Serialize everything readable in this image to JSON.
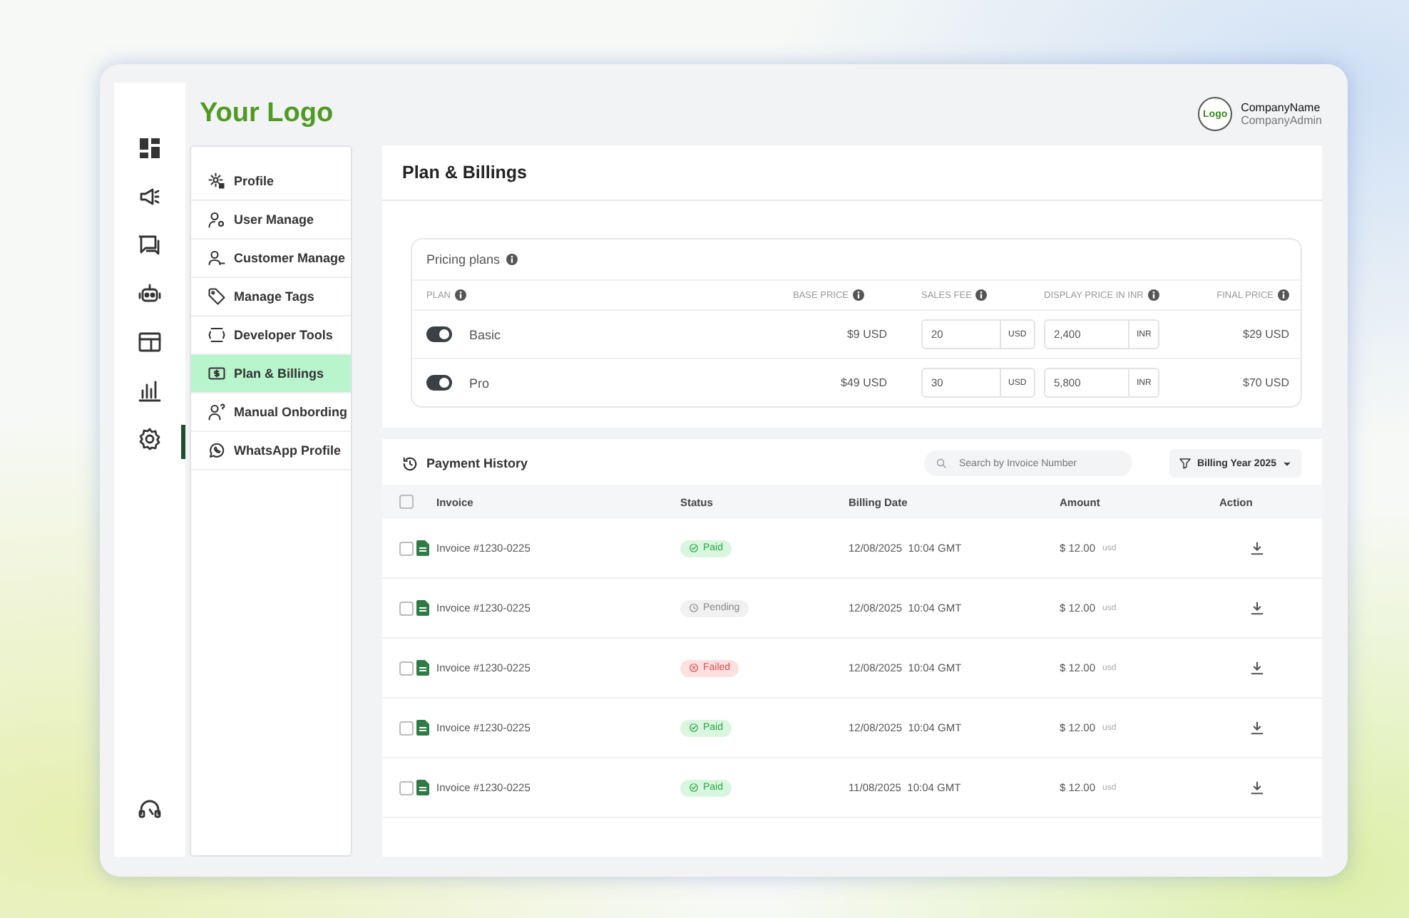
{
  "logo": "Your Logo",
  "company": {
    "avatar": "Logo",
    "name": "CompanyName",
    "role": "CompanyAdmin"
  },
  "rail": [
    {
      "kind": "dashboard",
      "selected": false
    },
    {
      "kind": "megaphone",
      "selected": false
    },
    {
      "kind": "chat",
      "selected": false
    },
    {
      "kind": "robot",
      "selected": false
    },
    {
      "kind": "layout",
      "selected": false
    },
    {
      "kind": "chart",
      "selected": false
    },
    {
      "kind": "settings",
      "selected": true
    }
  ],
  "rail_bottom": {
    "kind": "headset"
  },
  "settings_menu": [
    {
      "label": "Profile",
      "kind": "profile",
      "selected": false
    },
    {
      "label": "User Manage",
      "kind": "user",
      "selected": false
    },
    {
      "label": "Customer Manage",
      "kind": "customer",
      "selected": false
    },
    {
      "label": "Manage Tags",
      "kind": "tag",
      "selected": false
    },
    {
      "label": "Developer Tools",
      "kind": "code",
      "selected": false
    },
    {
      "label": "Plan & Billings",
      "kind": "billing",
      "selected": true
    },
    {
      "label": "Manual Onbording",
      "kind": "onboard",
      "selected": false
    },
    {
      "label": "WhatsApp Profile",
      "kind": "whatsapp",
      "selected": false
    }
  ],
  "page_title": "Plan & Billings",
  "pricing": {
    "title": "Pricing plans",
    "columns": [
      "PLAN",
      "BASE PRICE",
      "SALES FEE",
      "DISPLAY PRICE IN INR",
      "FINAL PRICE"
    ],
    "rows": [
      {
        "name": "Basic",
        "on": true,
        "base_price": "$9 USD",
        "sales_fee": "20",
        "fee_currency": "USD",
        "display_price": "2,400",
        "display_currency": "INR",
        "final_price": "$29 USD"
      },
      {
        "name": "Pro",
        "on": true,
        "base_price": "$49 USD",
        "sales_fee": "30",
        "fee_currency": "USD",
        "display_price": "5,800",
        "display_currency": "INR",
        "final_price": "$70 USD"
      }
    ]
  },
  "payment_history": {
    "title": "Payment History",
    "all_checked": false,
    "search": {
      "placeholder": "Search by Invoice Number"
    },
    "filter": "Billing Year 2025",
    "columns": [
      "Invoice",
      "Status",
      "Billing Date",
      "Amount",
      "Action"
    ],
    "rows": [
      {
        "invoice": "Invoice #1230-0225",
        "status": "Paid",
        "kind": "paid",
        "date": "12/08/2025  10:04 GMT",
        "amount": "$ 12.00",
        "currency": "usd",
        "checked": false
      },
      {
        "invoice": "Invoice #1230-0225",
        "status": "Pending",
        "kind": "pending",
        "date": "12/08/2025  10:04 GMT",
        "amount": "$ 12.00",
        "currency": "usd",
        "checked": false
      },
      {
        "invoice": "Invoice #1230-0225",
        "status": "Failed",
        "kind": "failed",
        "date": "12/08/2025  10:04 GMT",
        "amount": "$ 12.00",
        "currency": "usd",
        "checked": false
      },
      {
        "invoice": "Invoice #1230-0225",
        "status": "Paid",
        "kind": "paid",
        "date": "12/08/2025  10:04 GMT",
        "amount": "$ 12.00",
        "currency": "usd",
        "checked": false
      },
      {
        "invoice": "Invoice #1230-0225",
        "status": "Paid",
        "kind": "paid",
        "date": "11/08/2025  10:04 GMT",
        "amount": "$ 12.00",
        "currency": "usd",
        "checked": false
      }
    ]
  }
}
